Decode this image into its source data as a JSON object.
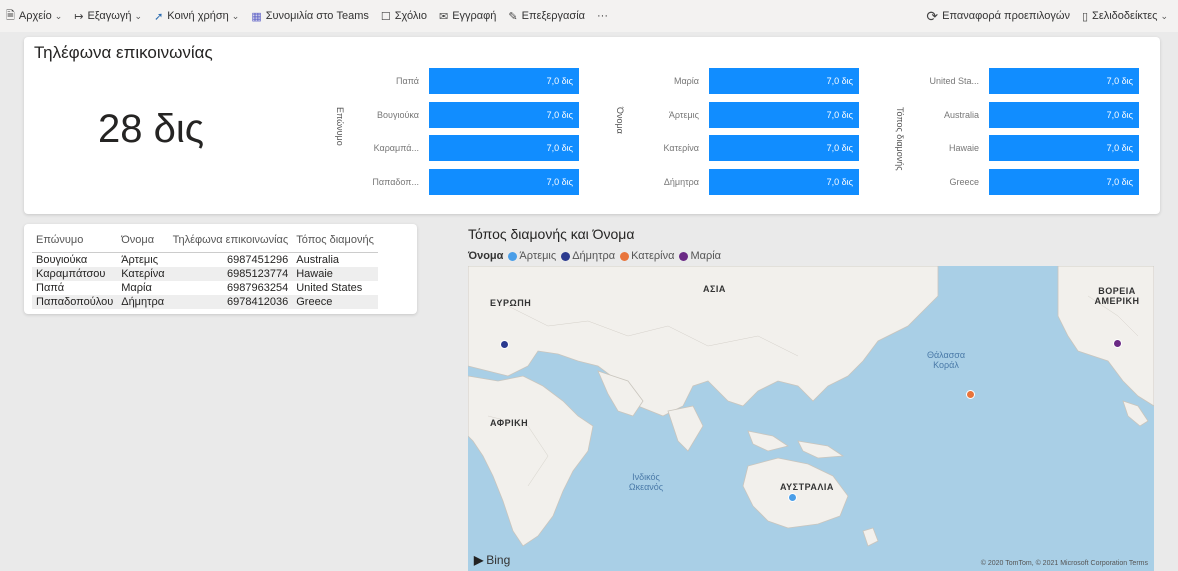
{
  "toolbar": {
    "file": "Αρχείο",
    "export": "Εξαγωγή",
    "share": "Κοινή χρήση",
    "teams": "Συνομιλία στο Teams",
    "comment": "Σχόλιο",
    "subscribe": "Εγγραφή",
    "edit": "Επεξεργασία",
    "more": "···",
    "reset": "Επαναφορά προεπιλογών",
    "bookmarks": "Σελιδοδείκτες"
  },
  "kpi_card": {
    "title": "Τηλέφωνα επικοινωνίας",
    "value": "28 δις"
  },
  "chart_data": [
    {
      "type": "bar",
      "ylabel": "Επώνυμο",
      "categories": [
        "Παπά",
        "Βουγιούκα",
        "Καραμπά...",
        "Παπαδοπ..."
      ],
      "values": [
        7.0,
        7.0,
        7.0,
        7.0
      ],
      "value_labels": [
        "7,0 δις",
        "7,0 δις",
        "7,0 δις",
        "7,0 δις"
      ],
      "color": "#118dff"
    },
    {
      "type": "bar",
      "ylabel": "Όνομα",
      "categories": [
        "Μαρία",
        "Άρτεμις",
        "Κατερίνα",
        "Δήμητρα"
      ],
      "values": [
        7.0,
        7.0,
        7.0,
        7.0
      ],
      "value_labels": [
        "7,0 δις",
        "7,0 δις",
        "7,0 δις",
        "7,0 δις"
      ],
      "color": "#118dff"
    },
    {
      "type": "bar",
      "ylabel": "Τόπος διαμονής",
      "categories": [
        "United Sta...",
        "Australia",
        "Hawaie",
        "Greece"
      ],
      "values": [
        7.0,
        7.0,
        7.0,
        7.0
      ],
      "value_labels": [
        "7,0 δις",
        "7,0 δις",
        "7,0 δις",
        "7,0 δις"
      ],
      "color": "#118dff"
    }
  ],
  "table": {
    "headers": [
      "Επώνυμο",
      "Όνομα",
      "Τηλέφωνα επικοινωνίας",
      "Τόπος διαμονής"
    ],
    "rows": [
      [
        "Βουγιούκα",
        "Άρτεμις",
        "6987451296",
        "Australia"
      ],
      [
        "Καραμπάτσου",
        "Κατερίνα",
        "6985123774",
        "Hawaie"
      ],
      [
        "Παπά",
        "Μαρία",
        "6987963254",
        "United States"
      ],
      [
        "Παπαδοπούλου",
        "Δήμητρα",
        "6978412036",
        "Greece"
      ]
    ]
  },
  "map": {
    "title": "Τόπος διαμονής και Όνομα",
    "legend_title": "Όνομα",
    "legend": [
      {
        "name": "Άρτεμις",
        "color": "#4a9ee8"
      },
      {
        "name": "Δήμητρα",
        "color": "#2b3a8f"
      },
      {
        "name": "Κατερίνα",
        "color": "#e8743b"
      },
      {
        "name": "Μαρία",
        "color": "#6b2a85"
      }
    ],
    "labels": {
      "europe": "ΕΥΡΩΠΗ",
      "asia": "ΑΣΙΑ",
      "africa": "ΑΦΡΙΚΗ",
      "australia": "ΑΥΣΤΡΑΛΙΑ",
      "north_america": "ΒΟΡΕΙΑ ΑΜΕΡΙΚΗ",
      "coral_sea": "Θάλασσα Κοράλ",
      "indian_ocean": "Ινδικός Ωκεανός"
    },
    "bing": "Bing",
    "copyright": "© 2020 TomTom, © 2021 Microsoft Corporation  Terms"
  }
}
